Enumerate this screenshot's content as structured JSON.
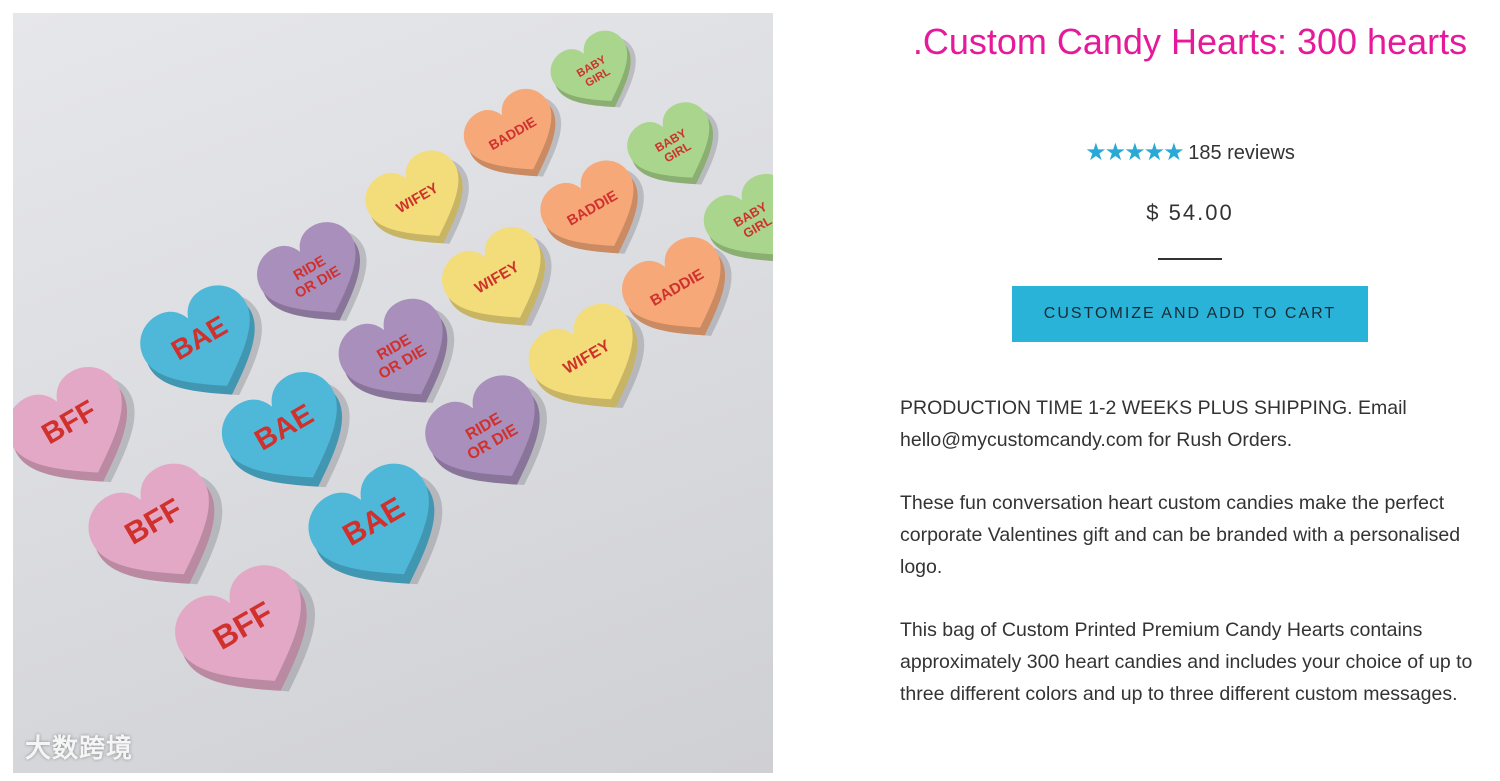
{
  "product": {
    "title": ".Custom Candy Hearts: 300 hearts",
    "rating_stars": 5,
    "reviews_label": "185 reviews",
    "price": "$ 54.00",
    "cta_label": "CUSTOMIZE AND ADD TO CART",
    "description": [
      "PRODUCTION TIME 1-2 WEEKS PLUS SHIPPING. Email hello@mycustomcandy.com for Rush Orders.",
      "These fun conversation heart custom candies make the perfect corporate Valentines gift and can be branded with a personalised logo.",
      "This bag of Custom Printed Premium Candy Hearts contains approximately 300 heart candies and includes your choice of up to three different colors and up to three different custom messages."
    ]
  },
  "image": {
    "watermark": "大数跨境",
    "hearts": [
      {
        "text": "BFF",
        "color": "#e3a8c6"
      },
      {
        "text": "BFF",
        "color": "#e3a8c6"
      },
      {
        "text": "BFF",
        "color": "#e3a8c6"
      },
      {
        "text": "BAE",
        "color": "#4fb8d8"
      },
      {
        "text": "BAE",
        "color": "#4fb8d8"
      },
      {
        "text": "BAE",
        "color": "#4fb8d8"
      },
      {
        "text": "RIDE OR DIE",
        "color": "#a88fbc"
      },
      {
        "text": "RIDE OR DIE",
        "color": "#a88fbc"
      },
      {
        "text": "RIDE OR DIE",
        "color": "#a88fbc"
      },
      {
        "text": "WIFEY",
        "color": "#f3dc7a"
      },
      {
        "text": "WIFEY",
        "color": "#f3dc7a"
      },
      {
        "text": "WIFEY",
        "color": "#f3dc7a"
      },
      {
        "text": "BADDIE",
        "color": "#f6a878"
      },
      {
        "text": "BADDIE",
        "color": "#f6a878"
      },
      {
        "text": "BADDIE",
        "color": "#f6a878"
      },
      {
        "text": "BABY GIRL",
        "color": "#a9d68c"
      },
      {
        "text": "BABY GIRL",
        "color": "#a9d68c"
      },
      {
        "text": "BABY GIRL",
        "color": "#a9d68c"
      }
    ]
  },
  "colors": {
    "title": "#e5199a",
    "accent": "#29b3d9",
    "stars": "#29a9d6",
    "heart_text": "#d0312d"
  }
}
